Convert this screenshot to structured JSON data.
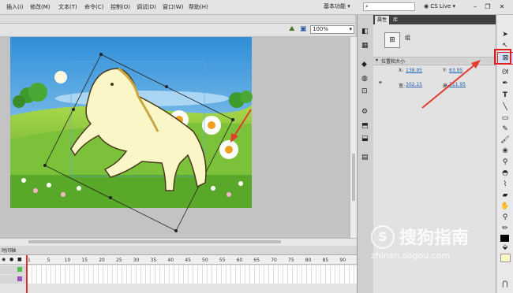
{
  "menubar": {
    "items": [
      "插入(I)",
      "修改(M)",
      "文本(T)",
      "命令(C)",
      "控制(O)",
      "调试(D)",
      "窗口(W)",
      "帮助(H)"
    ],
    "workspace": "基本功能",
    "cslive": "CS Live"
  },
  "toolbar2": {
    "zoom": "100%"
  },
  "timeline": {
    "label": "时间轴",
    "frame_numbers": [
      "1",
      "5",
      "10",
      "15",
      "20",
      "25",
      "30",
      "35",
      "40",
      "45",
      "50",
      "55",
      "60",
      "65",
      "70",
      "75",
      "80",
      "85",
      "90"
    ]
  },
  "properties": {
    "tabs": [
      "属性",
      "库"
    ],
    "instance_type": "组",
    "section": "位置和大小",
    "x_label": "X:",
    "x_value": "138.95",
    "y_label": "Y:",
    "y_value": "63.95",
    "w_label": "宽:",
    "w_value": "302.15",
    "h_label": "高:",
    "h_value": "311.95"
  },
  "watermark": {
    "text": "搜狗指南",
    "url": "zhinan.sogou.com"
  },
  "colors": {
    "annotation": "#e53b2c",
    "tool_highlight": "#e02020",
    "link": "#1a5fb4"
  }
}
